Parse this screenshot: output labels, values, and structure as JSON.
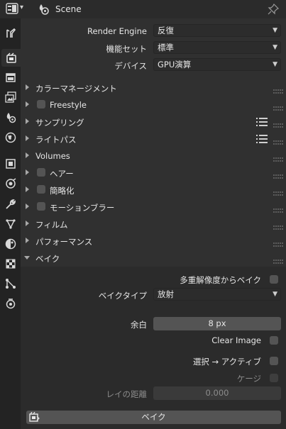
{
  "header": {
    "title": "Scene",
    "editor_icon": "properties-editor-icon",
    "scene_icon": "scene-icon",
    "pin_icon": "pin-icon"
  },
  "tabs": [
    {
      "name": "tool",
      "icon": "tool-icon"
    },
    {
      "name": "render",
      "icon": "render-icon",
      "active": true
    },
    {
      "name": "output",
      "icon": "output-icon"
    },
    {
      "name": "view-layer",
      "icon": "view-layer-icon"
    },
    {
      "name": "scene",
      "icon": "scene-icon"
    },
    {
      "name": "world",
      "icon": "world-icon"
    },
    {
      "name": "object",
      "icon": "object-icon"
    },
    {
      "name": "physics",
      "icon": "physics-icon"
    },
    {
      "name": "modifiers",
      "icon": "wrench-icon"
    },
    {
      "name": "particles",
      "icon": "particles-icon"
    },
    {
      "name": "material",
      "icon": "material-icon"
    },
    {
      "name": "texture",
      "icon": "texture-icon"
    },
    {
      "name": "constraints",
      "icon": "constraints-icon"
    },
    {
      "name": "object-data",
      "icon": "object-data-icon"
    }
  ],
  "render": {
    "engine_label": "Render Engine",
    "engine_value": "反復",
    "feature_set_label": "機能セット",
    "feature_set_value": "標準",
    "device_label": "デバイス",
    "device_value": "GPU演算"
  },
  "sections": {
    "color_management": "カラーマネージメント",
    "freestyle": "Freestyle",
    "sampling": "サンプリング",
    "light_paths": "ライトパス",
    "volumes": "Volumes",
    "hair": "ヘアー",
    "simplify": "簡略化",
    "motion_blur": "モーションブラー",
    "film": "フィルム",
    "performance": "パフォーマンス",
    "bake": "ベイク"
  },
  "bake": {
    "multires_label": "多重解像度からベイク",
    "bake_type_label": "ベイクタイプ",
    "bake_type_value": "放射",
    "margin_label": "余白",
    "margin_value": "8 px",
    "clear_image_label": "Clear Image",
    "selected_to_active_label": "選択 → アクティブ",
    "cage_label": "ケージ",
    "ray_distance_label": "レイの距離",
    "ray_distance_value": "0.000",
    "bake_button_label": "ベイク"
  },
  "colors": {
    "panel_bg": "#303030",
    "subpanel_bg": "#2b2b2b",
    "tab_strip_bg": "#232323",
    "field_bg": "#545454",
    "dropdown_bg": "#2c2c2c",
    "text": "#e6e6e6"
  }
}
